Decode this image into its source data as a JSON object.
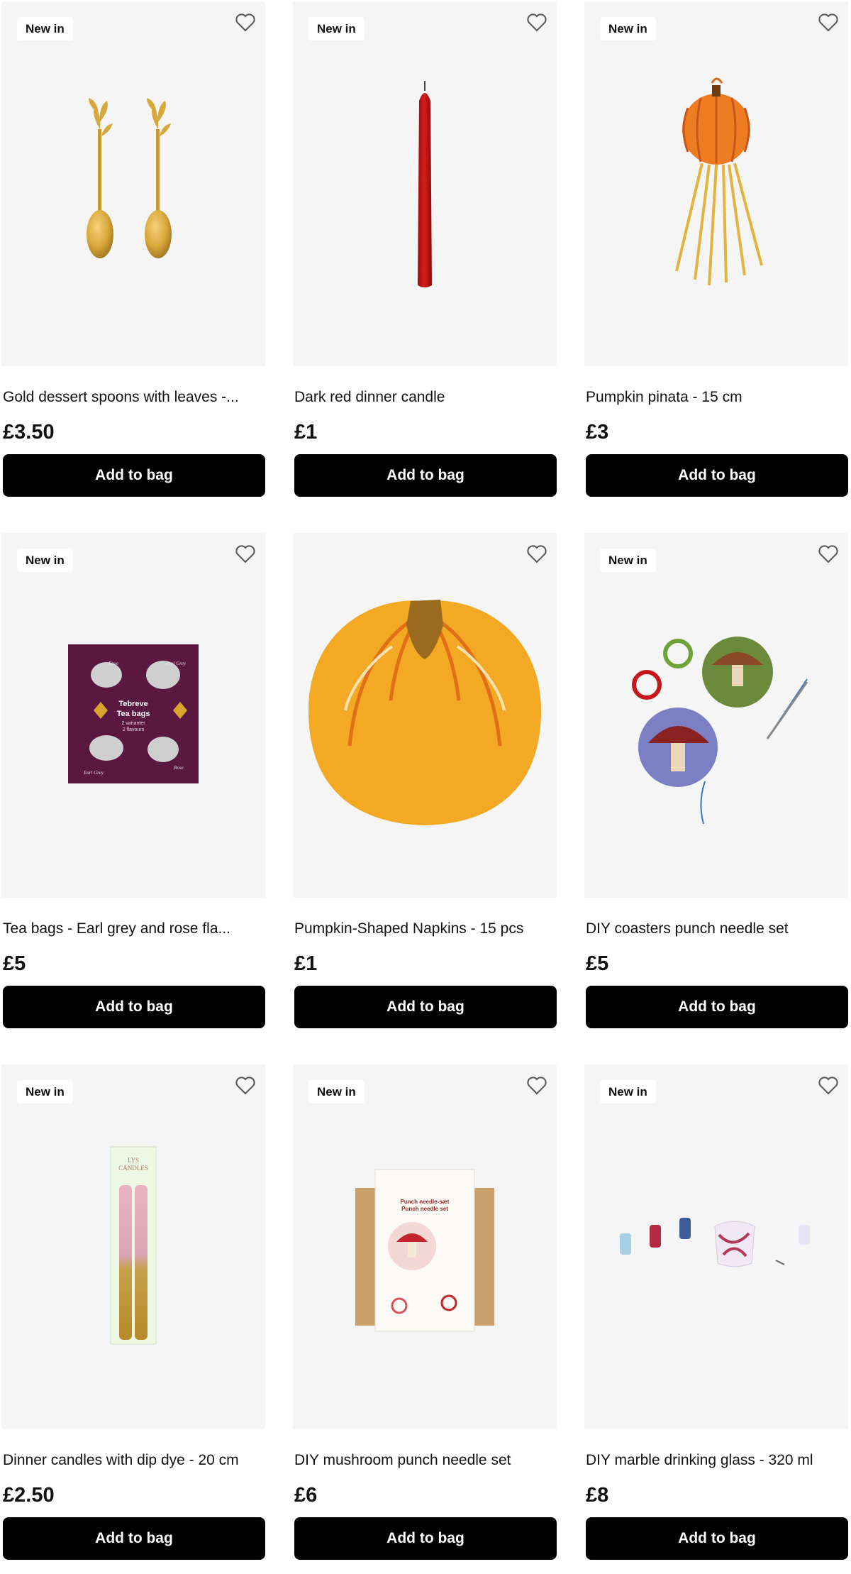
{
  "products": [
    {
      "badge": "New in",
      "title": "Gold dessert spoons with leaves -...",
      "price": "£3.50",
      "button": "Add to bag",
      "icon": "gold-spoons-image"
    },
    {
      "badge": "New in",
      "title": "Dark red dinner candle",
      "price": "£1",
      "button": "Add to bag",
      "icon": "red-candle-image"
    },
    {
      "badge": "New in",
      "title": "Pumpkin pinata - 15 cm",
      "price": "£3",
      "button": "Add to bag",
      "icon": "pumpkin-pinata-image"
    },
    {
      "badge": "New in",
      "title": "Tea bags - Earl grey and rose fla...",
      "price": "£5",
      "button": "Add to bag",
      "icon": "tea-bags-image",
      "pack_text": {
        "brand_line1": "Tebreve",
        "brand_line2": "Tea bags",
        "sub1": "2 varianter",
        "sub2": "2 flavours",
        "label_rose": "Rose",
        "label_earl": "Earl Grey"
      }
    },
    {
      "badge": "",
      "title": "Pumpkin-Shaped Napkins - 15 pcs",
      "price": "£1",
      "button": "Add to bag",
      "icon": "pumpkin-napkin-image"
    },
    {
      "badge": "New in",
      "title": "DIY coasters punch needle set",
      "price": "£5",
      "button": "Add to bag",
      "icon": "punch-needle-coasters-image"
    },
    {
      "badge": "New in",
      "title": "Dinner candles with dip dye - 20 cm",
      "price": "£2.50",
      "button": "Add to bag",
      "icon": "dip-dye-candles-image",
      "pack_text": {
        "line1": "LYS",
        "line2": "CANDLES"
      }
    },
    {
      "badge": "New in",
      "title": "DIY mushroom punch needle set",
      "price": "£6",
      "button": "Add to bag",
      "icon": "mushroom-punch-needle-image",
      "pack_text": {
        "line1": "Punch needle-sæt",
        "line2": "Punch needle set"
      }
    },
    {
      "badge": "New in",
      "title": "DIY marble drinking glass - 320 ml",
      "price": "£8",
      "button": "Add to bag",
      "icon": "marble-glass-image"
    }
  ],
  "colors": {
    "button_bg": "#000000",
    "image_bg": "#f5f5f5",
    "badge_bg": "#ffffff"
  }
}
